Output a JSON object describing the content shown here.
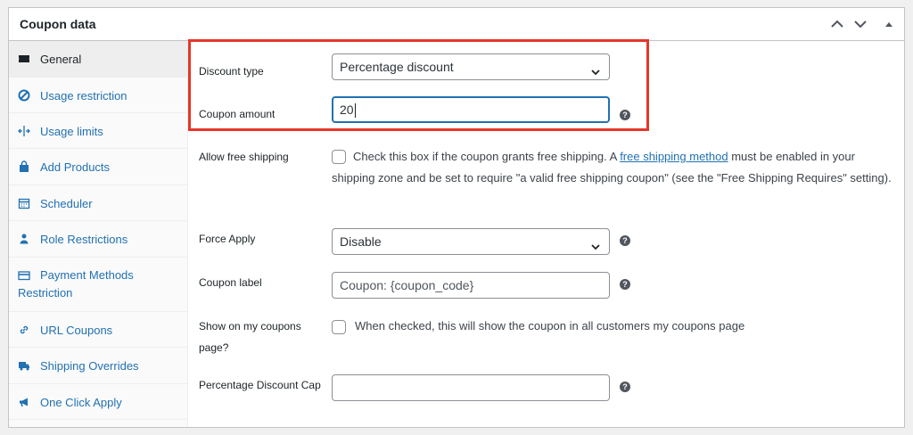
{
  "panel": {
    "title": "Coupon data",
    "controls": [
      "chevron-up-icon",
      "chevron-down-icon",
      "triangle-up-icon"
    ]
  },
  "sidebar": {
    "items": [
      {
        "label": "General",
        "icon": "ticket-icon",
        "active": true
      },
      {
        "label": "Usage restriction",
        "icon": "prohibited-icon"
      },
      {
        "label": "Usage limits",
        "icon": "arrows-icon"
      },
      {
        "label": "Add Products",
        "icon": "bag-icon"
      },
      {
        "label": "Scheduler",
        "icon": "calendar-icon"
      },
      {
        "label": "Role Restrictions",
        "icon": "person-icon"
      },
      {
        "label": "Payment Methods Restriction",
        "icon": "card-icon"
      },
      {
        "label": "URL Coupons",
        "icon": "link-icon"
      },
      {
        "label": "Shipping Overrides",
        "icon": "truck-icon"
      },
      {
        "label": "One Click Apply",
        "icon": "megaphone-icon"
      }
    ]
  },
  "form": {
    "discount_type": {
      "label": "Discount type",
      "value": "Percentage discount"
    },
    "coupon_amount": {
      "label": "Coupon amount",
      "value": "20"
    },
    "free_shipping": {
      "label": "Allow free shipping",
      "text_before": "Check this box if the coupon grants free shipping. A ",
      "link": "free shipping method",
      "text_after": " must be enabled in your shipping zone and be set to require \"a valid free shipping coupon\" (see the \"Free Shipping Requires\" setting).",
      "checked": false
    },
    "force_apply": {
      "label": "Force Apply",
      "value": "Disable"
    },
    "coupon_label": {
      "label": "Coupon label",
      "placeholder": "Coupon: {coupon_code}"
    },
    "show_on_coupons": {
      "label": "Show on my coupons page?",
      "text": "When checked, this will show the coupon in all customers my coupons page",
      "checked": false
    },
    "percentage_cap": {
      "label": "Percentage Discount Cap",
      "value": ""
    }
  },
  "colors": {
    "accent": "#2271b1",
    "highlight": "#e5362a"
  }
}
